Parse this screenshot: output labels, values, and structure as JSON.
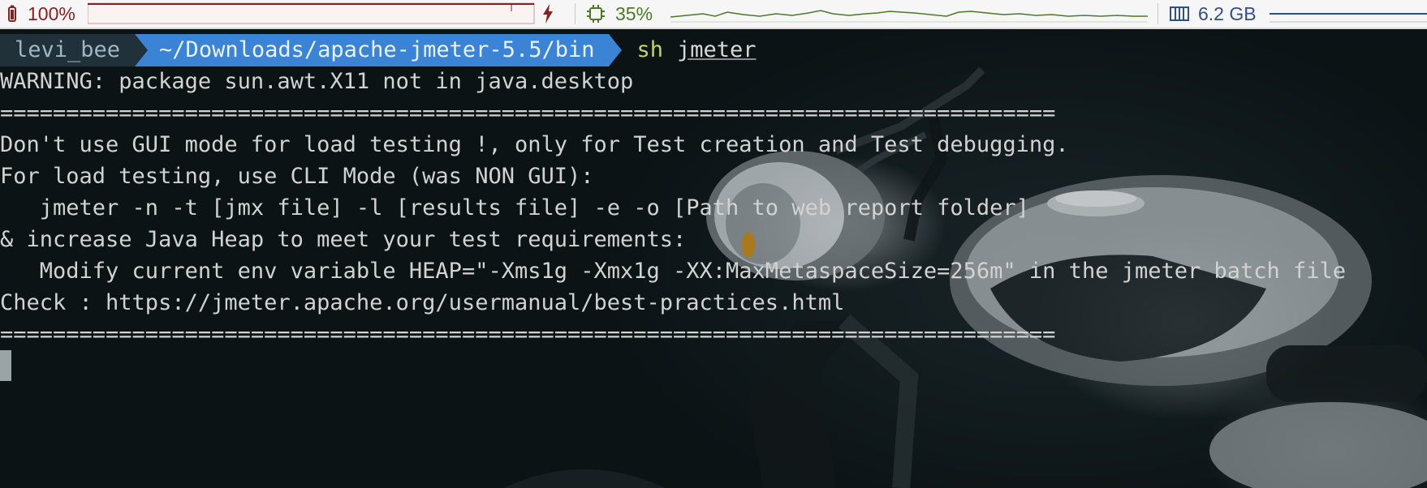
{
  "statusbar": {
    "battery": {
      "icon": "battery-icon",
      "percent": "100%",
      "charging_icon": "bolt-icon",
      "color": "#8a1f1f",
      "level": 1.0
    },
    "cpu": {
      "icon": "cpu-chip-icon",
      "percent": "35%",
      "color": "#4c7a23"
    },
    "memory": {
      "icon": "memory-icon",
      "value": "6.2 GB",
      "color": "#2f4f86"
    }
  },
  "prompt": {
    "user": "levi_bee",
    "path": "~/Downloads/apache-jmeter-5.5/bin",
    "command": "sh",
    "argument": "jmeter",
    "user_bg": "#20313a",
    "path_bg": "#3b83d4"
  },
  "output": {
    "lines": [
      "WARNING: package sun.awt.X11 not in java.desktop",
      "================================================================================",
      "Don't use GUI mode for load testing !, only for Test creation and Test debugging.",
      "For load testing, use CLI Mode (was NON GUI):",
      "   jmeter -n -t [jmx file] -l [results file] -e -o [Path to web report folder]",
      "& increase Java Heap to meet your test requirements:",
      "   Modify current env variable HEAP=\"-Xms1g -Xmx1g -XX:MaxMetaspaceSize=256m\" in the jmeter batch file",
      "Check : https://jmeter.apache.org/usermanual/best-practices.html",
      "================================================================================"
    ]
  }
}
